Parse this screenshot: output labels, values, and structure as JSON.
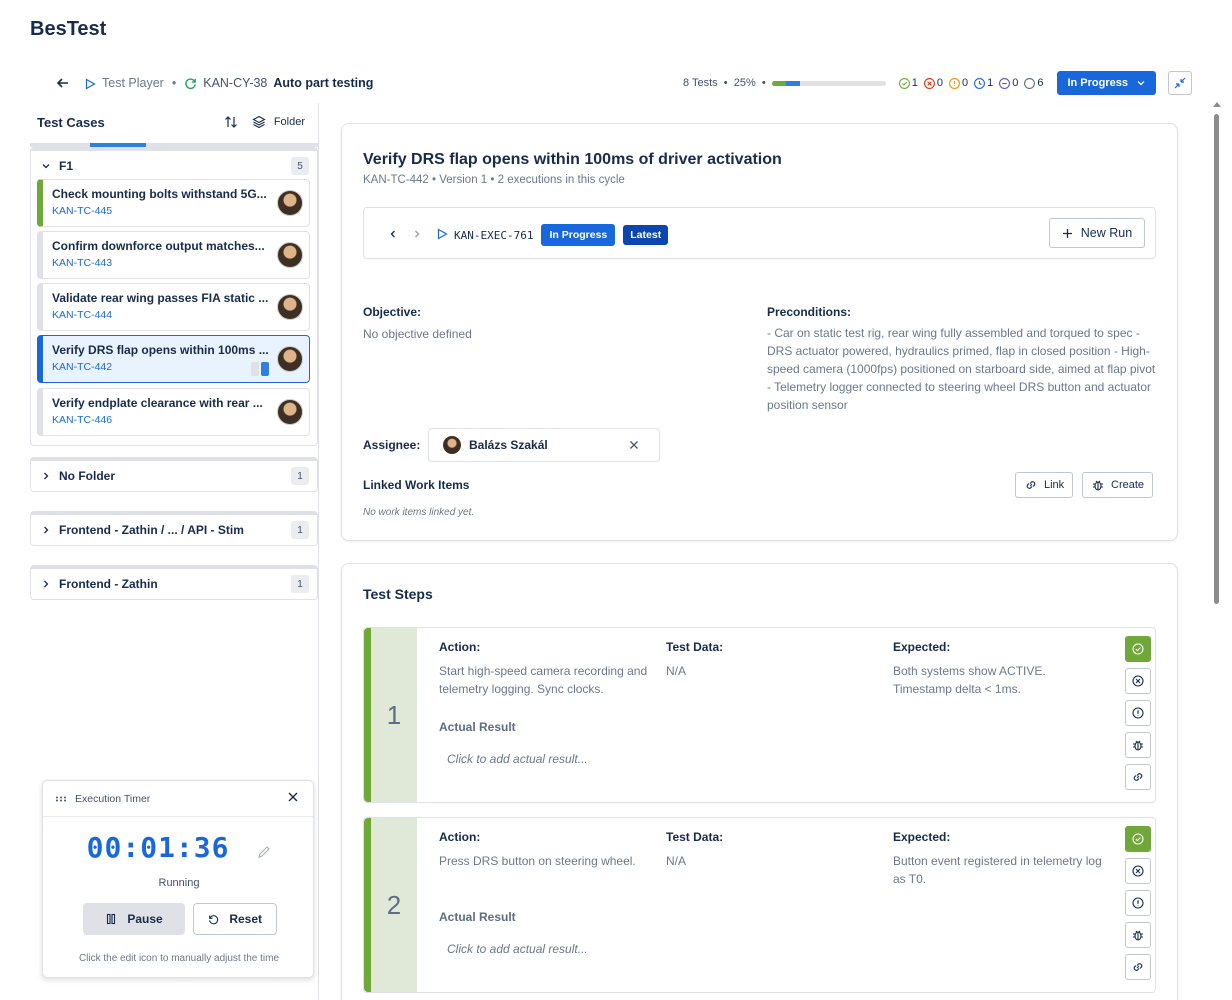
{
  "app": {
    "title": "BesTest"
  },
  "toolbar": {
    "back_icon": "arrow-left-icon",
    "player_label": "Test Player",
    "separator": "•",
    "cycle_key": "KAN-CY-38",
    "cycle_name": "Auto part testing",
    "summary": "8 Tests  •  25%  •",
    "progress": {
      "passed_fraction": 0.125,
      "in_progress_fraction": 0.125
    },
    "counts": [
      {
        "icon": "check-circle-icon",
        "value": "1",
        "color": "#6fa839"
      },
      {
        "icon": "x-circle-icon",
        "value": "0",
        "color": "#de350b"
      },
      {
        "icon": "alert-circle-icon",
        "value": "0",
        "color": "#ff8b00"
      },
      {
        "icon": "clock-circle-icon",
        "value": "1",
        "color": "#1868db"
      },
      {
        "icon": "minus-circle-icon",
        "value": "0",
        "color": "#6554c0"
      },
      {
        "icon": "empty-circle-icon",
        "value": "6",
        "color": "#5e6c84"
      }
    ],
    "status_label": "In Progress"
  },
  "left": {
    "title": "Test Cases",
    "folder_label": "Folder",
    "folders": [
      {
        "name": "F1",
        "count": "5",
        "expanded": true,
        "cases": [
          {
            "title": "Check mounting bolts withstand 5G...",
            "key": "KAN-TC-445",
            "status": "passed"
          },
          {
            "title": "Confirm downforce output matches...",
            "key": "KAN-TC-443",
            "status": "none"
          },
          {
            "title": "Validate rear wing passes FIA static ...",
            "key": "KAN-TC-444",
            "status": "none"
          },
          {
            "title": "Verify DRS flap opens within 100ms ...",
            "key": "KAN-TC-442",
            "status": "selected"
          },
          {
            "title": "Verify endplate clearance with rear ...",
            "key": "KAN-TC-446",
            "status": "none"
          }
        ]
      },
      {
        "name": "No Folder",
        "count": "1",
        "expanded": false
      },
      {
        "name": "Frontend - Zathin / ... / API - Stim",
        "count": "1",
        "expanded": false
      },
      {
        "name": "Frontend - Zathin",
        "count": "1",
        "expanded": false
      }
    ]
  },
  "timer": {
    "title": "Execution Timer",
    "value": "00:01:36",
    "status": "Running",
    "pause_label": "Pause",
    "reset_label": "Reset",
    "hint": "Click the edit icon to manually adjust the time"
  },
  "case": {
    "title": "Verify DRS flap opens within 100ms of driver activation",
    "meta": "KAN-TC-442 • Version 1 • 2 executions in this cycle",
    "execution": {
      "key": "KAN-EXEC-761",
      "status": "In Progress",
      "tag": "Latest",
      "new_run_label": "New Run"
    },
    "objective_label": "Objective:",
    "objective": "No objective defined",
    "preconditions_label": "Preconditions:",
    "preconditions": "- Car on static test rig, rear wing fully assembled and torqued to spec - DRS actuator powered, hydraulics primed, flap in closed position - High-speed camera (1000fps) positioned on starboard side, aimed at flap pivot - Telemetry logger connected to steering wheel DRS button and actuator position sensor",
    "assignee_label": "Assignee:",
    "assignee": "Balázs Szakál",
    "linked_label": "Linked Work Items",
    "linked_empty": "No work items linked yet.",
    "link_label": "Link",
    "create_label": "Create"
  },
  "steps": {
    "title": "Test Steps",
    "action_label": "Action:",
    "data_label": "Test Data:",
    "expected_label": "Expected:",
    "actual_label": "Actual Result",
    "actual_placeholder": "Click to add actual result...",
    "items": [
      {
        "number": "1",
        "action": "Start high-speed camera recording and telemetry logging. Sync clocks.",
        "data": "N/A",
        "expected": "Both systems show ACTIVE. Timestamp delta < 1ms."
      },
      {
        "number": "2",
        "action": "Press DRS button on steering wheel.",
        "data": "N/A",
        "expected": "Button event registered in telemetry log as T0."
      }
    ]
  }
}
